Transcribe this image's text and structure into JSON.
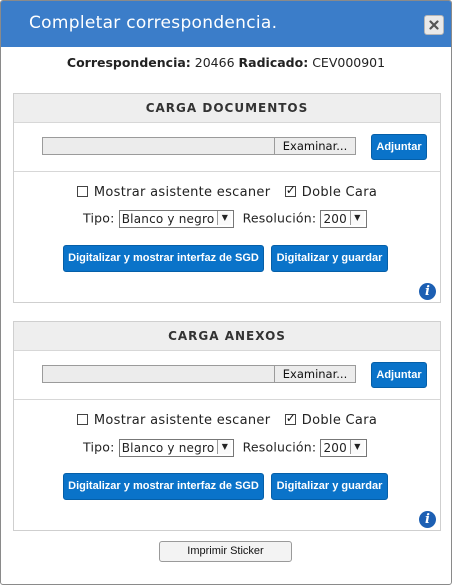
{
  "dialog": {
    "title": "Completar correspondencia.",
    "close_icon": "close-icon"
  },
  "info": {
    "correspondencia_label": "Correspondencia:",
    "correspondencia_value": "20466",
    "radicado_label": "Radicado:",
    "radicado_value": "CEV000901"
  },
  "documentos": {
    "header": "CARGA DOCUMENTOS",
    "browse_label": "Examinar...",
    "attach_label": "Adjuntar",
    "show_scanner_label": "Mostrar asistente escaner",
    "show_scanner_checked": false,
    "double_side_label": "Doble Cara",
    "double_side_checked": true,
    "tipo_label": "Tipo:",
    "tipo_value": "Blanco y negro",
    "resolucion_label": "Resolución:",
    "resolucion_value": "200",
    "scan_show_label": "Digitalizar y mostrar interfaz de SGD",
    "scan_save_label": "Digitalizar y guardar",
    "info_icon": "i"
  },
  "anexos": {
    "header": "CARGA ANEXOS",
    "browse_label": "Examinar...",
    "attach_label": "Adjuntar",
    "show_scanner_label": "Mostrar asistente escaner",
    "show_scanner_checked": false,
    "double_side_label": "Doble Cara",
    "double_side_checked": true,
    "tipo_label": "Tipo:",
    "tipo_value": "Blanco y negro",
    "resolucion_label": "Resolución:",
    "resolucion_value": "200",
    "scan_show_label": "Digitalizar y mostrar interfaz de SGD",
    "scan_save_label": "Digitalizar y guardar",
    "info_icon": "i"
  },
  "footer": {
    "print_label": "Imprimir Sticker"
  },
  "colors": {
    "titlebar": "#3b7dc9",
    "button": "#0a73c9",
    "info_icon": "#1c5fb3"
  }
}
